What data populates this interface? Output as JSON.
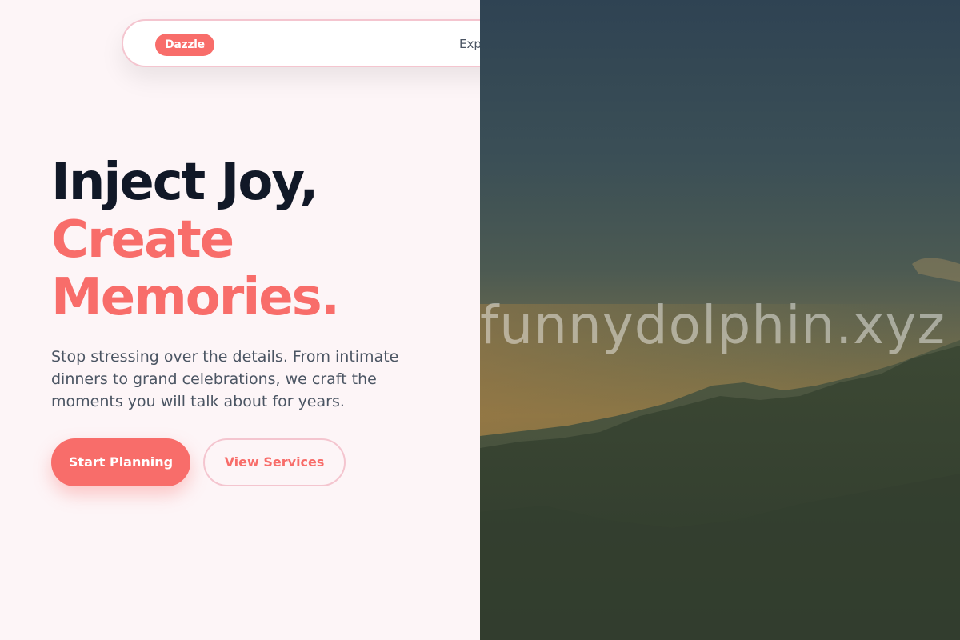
{
  "nav": {
    "logo": "Dazzle",
    "link_partial": "Exp"
  },
  "hero": {
    "title_line1": "Inject Joy,",
    "title_line2": "Create",
    "title_line3": "Memories.",
    "description": "Stop stressing over the details. From intimate dinners to grand celebrations, we craft the moments you will talk about for years."
  },
  "buttons": {
    "primary_label": "Start Planning",
    "secondary_label": "View Services"
  },
  "image": {
    "watermark": "funnydolphin.xyz"
  },
  "colors": {
    "accent": "#f86d6a",
    "heading": "#111827",
    "body_text": "#4b5563",
    "background": "#fdf5f7"
  }
}
